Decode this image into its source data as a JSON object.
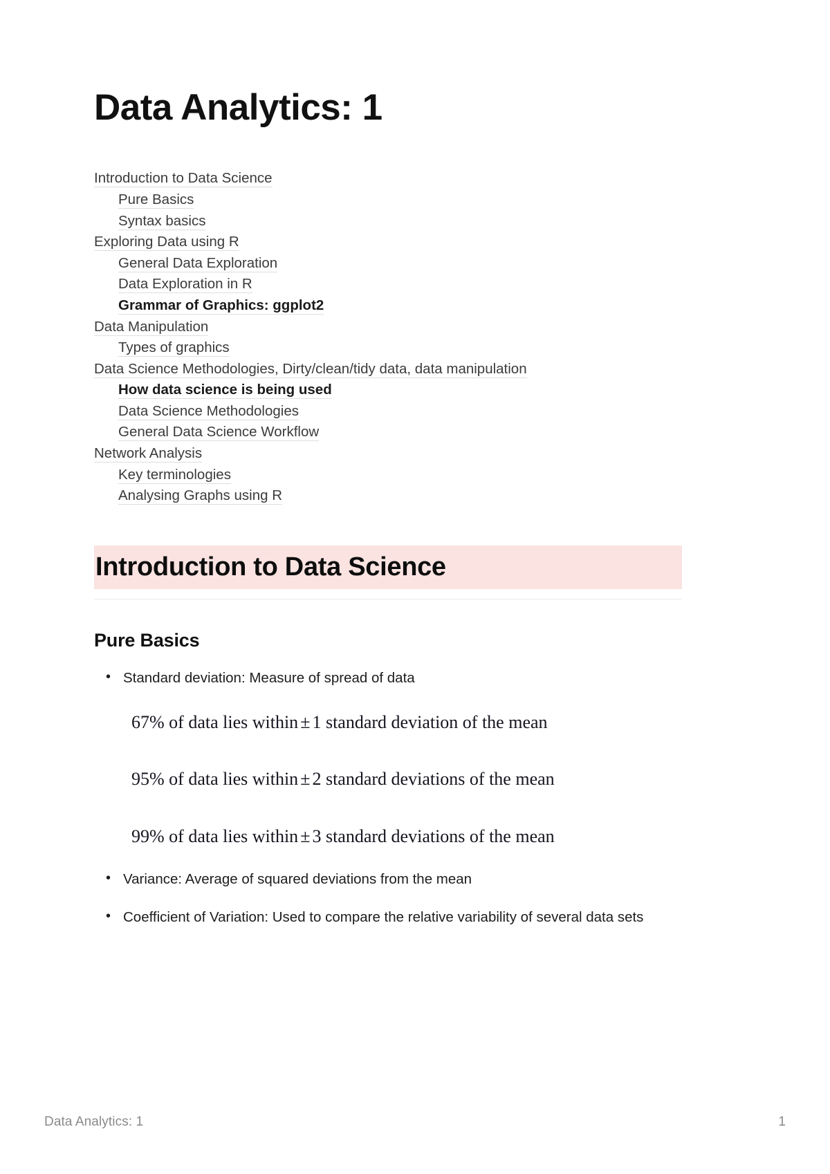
{
  "document": {
    "title": "Data Analytics: 1"
  },
  "toc": {
    "items": [
      {
        "label": "Introduction to Data Science",
        "level": 1,
        "bold": false
      },
      {
        "label": "Pure Basics",
        "level": 2,
        "bold": false
      },
      {
        "label": "Syntax basics",
        "level": 2,
        "bold": false
      },
      {
        "label": "Exploring Data using R",
        "level": 1,
        "bold": false
      },
      {
        "label": "General Data Exploration",
        "level": 2,
        "bold": false
      },
      {
        "label": "Data Exploration in R",
        "level": 2,
        "bold": false
      },
      {
        "label": "Grammar of Graphics: ggplot2",
        "level": 2,
        "bold": true
      },
      {
        "label": "Data Manipulation",
        "level": 1,
        "bold": false
      },
      {
        "label": "Types of graphics",
        "level": 2,
        "bold": false
      },
      {
        "label": "Data Science Methodologies, Dirty/clean/tidy data, data manipulation",
        "level": 1,
        "bold": false
      },
      {
        "label": "How data science is being used",
        "level": 2,
        "bold": true
      },
      {
        "label": "Data Science Methodologies",
        "level": 2,
        "bold": false
      },
      {
        "label": "General Data Science Workflow",
        "level": 2,
        "bold": false
      },
      {
        "label": "Network Analysis",
        "level": 1,
        "bold": false
      },
      {
        "label": "Key terminologies",
        "level": 2,
        "bold": false
      },
      {
        "label": "Analysing Graphs using R",
        "level": 2,
        "bold": false
      }
    ]
  },
  "section": {
    "heading": "Introduction to Data Science",
    "highlight_color": "#fae3e1",
    "subheading": "Pure Basics",
    "bullet_first": "Standard deviation: Measure of spread of data",
    "math_lines": [
      {
        "prefix": "67% of data lies within",
        "symbol": "±",
        "suffix": "1 standard deviation of  the mean"
      },
      {
        "prefix": "95% of data lies within",
        "symbol": "±",
        "suffix": "2 standard deviations of the mean"
      },
      {
        "prefix": "99% of data lies within",
        "symbol": "±",
        "suffix": "3 standard deviations of the mean"
      }
    ],
    "bullet_variance": "Variance: Average of squared deviations from the mean",
    "bullet_cv": "Coefficient of Variation: Used to compare the relative variability of several data sets"
  },
  "footer": {
    "left": "Data Analytics: 1",
    "page_number": "1"
  }
}
